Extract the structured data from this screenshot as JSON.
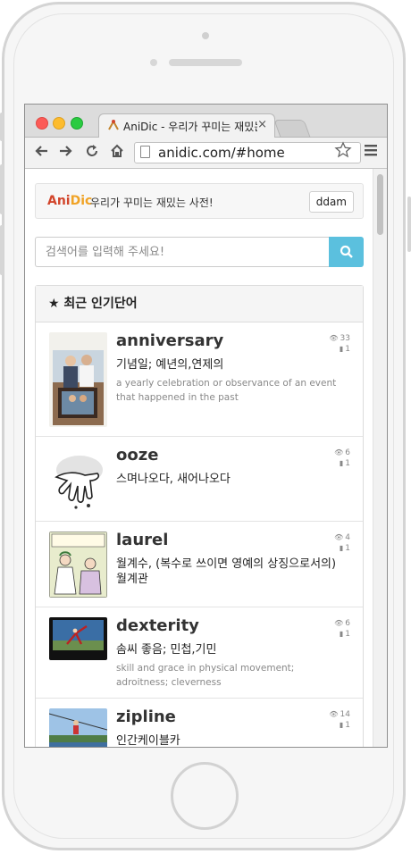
{
  "browser": {
    "tab_title": "AniDic - 우리가 꾸미는 재밌는",
    "tab_close": "×",
    "url": "anidic.com/#home"
  },
  "site": {
    "logo_ani": "Ani",
    "logo_dic": "Dic",
    "tagline": "우리가 꾸미는 재밌는 사전!",
    "user": "ddam"
  },
  "search": {
    "placeholder": "검색어를 입력해 주세요!"
  },
  "popular": {
    "heading": "★ 최근 인기단어",
    "items": [
      {
        "word": "anniversary",
        "meaning": "기념일; 예년의,연제의",
        "description": "a yearly celebration or observance of an event that happened in the past",
        "views": "33",
        "bookmarks": "1"
      },
      {
        "word": "ooze",
        "meaning": "스며나오다, 새어나오다",
        "description": "",
        "views": "6",
        "bookmarks": "1"
      },
      {
        "word": "laurel",
        "meaning": "월계수, (복수로 쓰이면 영예의 상징으로서의) 월계관",
        "description": "",
        "views": "4",
        "bookmarks": "1"
      },
      {
        "word": "dexterity",
        "meaning": "솜씨 좋음; 민첩,기민",
        "description": "skill and grace in physical movement; adroitness; cleverness",
        "views": "6",
        "bookmarks": "1"
      },
      {
        "word": "zipline",
        "meaning": "인간케이블카",
        "description": "",
        "views": "14",
        "bookmarks": "1"
      }
    ]
  },
  "image_text": {
    "anniversary_caption": "Every anniversary take a picture with last year's photo. Imagine what it will look like in 50 years!",
    "laurel_caption": "Excuse me, but you're resting on my laurels.",
    "dexterity_caption": "DEXTERITY"
  },
  "colors": {
    "logo_ani": "#d2452b",
    "logo_dic": "#f0a326",
    "search_button": "#5bc0de"
  },
  "icons": {
    "search": "search-icon",
    "views": "eye-icon",
    "bookmarks": "bookmark-icon"
  }
}
